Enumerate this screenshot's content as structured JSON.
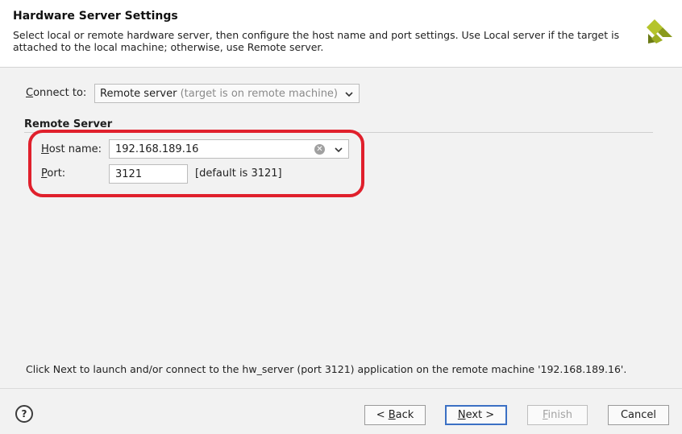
{
  "header": {
    "title": "Hardware Server Settings",
    "description": "Select local or remote hardware server, then configure the host name and port settings. Use Local server if the target is attached to the local machine; otherwise, use Remote server.",
    "logo_icon": "xilinx-logo"
  },
  "connect": {
    "label_accel": "C",
    "label_rest": "onnect to:",
    "value": "Remote server",
    "value_hint": " (target is on remote machine)"
  },
  "remote_server": {
    "section_title": "Remote Server",
    "host_label_accel": "H",
    "host_label_rest": "ost name:",
    "host_value": "192.168.189.16",
    "port_label_accel": "P",
    "port_label_rest": "ort:",
    "port_value": "3121",
    "port_hint": "[default is 3121]"
  },
  "footer_message": "Click Next to launch and/or connect to the hw_server (port 3121) application on the remote machine '192.168.189.16'.",
  "buttons": {
    "back_prefix": "< ",
    "back_accel": "B",
    "back_rest": "ack",
    "next_accel": "N",
    "next_rest": "ext >",
    "finish_accel": "F",
    "finish_rest": "inish",
    "cancel": "Cancel"
  },
  "colors": {
    "annotation": "#e0202c",
    "primary_border": "#3b70c4",
    "logo_dark": "#6b7a14",
    "logo_light": "#b5c42a"
  }
}
